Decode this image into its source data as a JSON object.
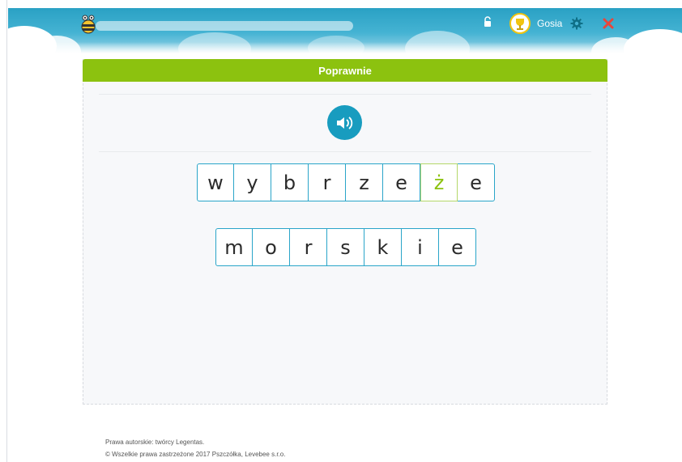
{
  "header": {
    "username": "Gosia",
    "progress_fraction": 0.0,
    "icons": {
      "mascot": "bee-mascot-icon",
      "lock": "lock-icon",
      "avatar": "avatar-trophy-icon",
      "settings": "gear-icon",
      "close": "close-icon"
    }
  },
  "panel": {
    "title": "Poprawnie",
    "sound_button_icon": "speaker-icon",
    "words": [
      {
        "letters": [
          "w",
          "y",
          "b",
          "r",
          "z",
          "e",
          "ż",
          "e"
        ],
        "highlighted_index": 6
      },
      {
        "letters": [
          "m",
          "o",
          "r",
          "s",
          "k",
          "i",
          "e"
        ],
        "highlighted_index": -1
      }
    ]
  },
  "footer": {
    "line1": "Prawa autorskie: twórcy Legentas.",
    "line2": "© Wszelkie prawa zastrzeżone 2017 Pszczółka, Levebee s.r.o."
  },
  "colors": {
    "header_blue": "#2aa1c4",
    "success_green": "#8cc20f",
    "tile_border": "#2aa5c9",
    "sound_button": "#189cbf",
    "close_red": "#e8463b"
  }
}
